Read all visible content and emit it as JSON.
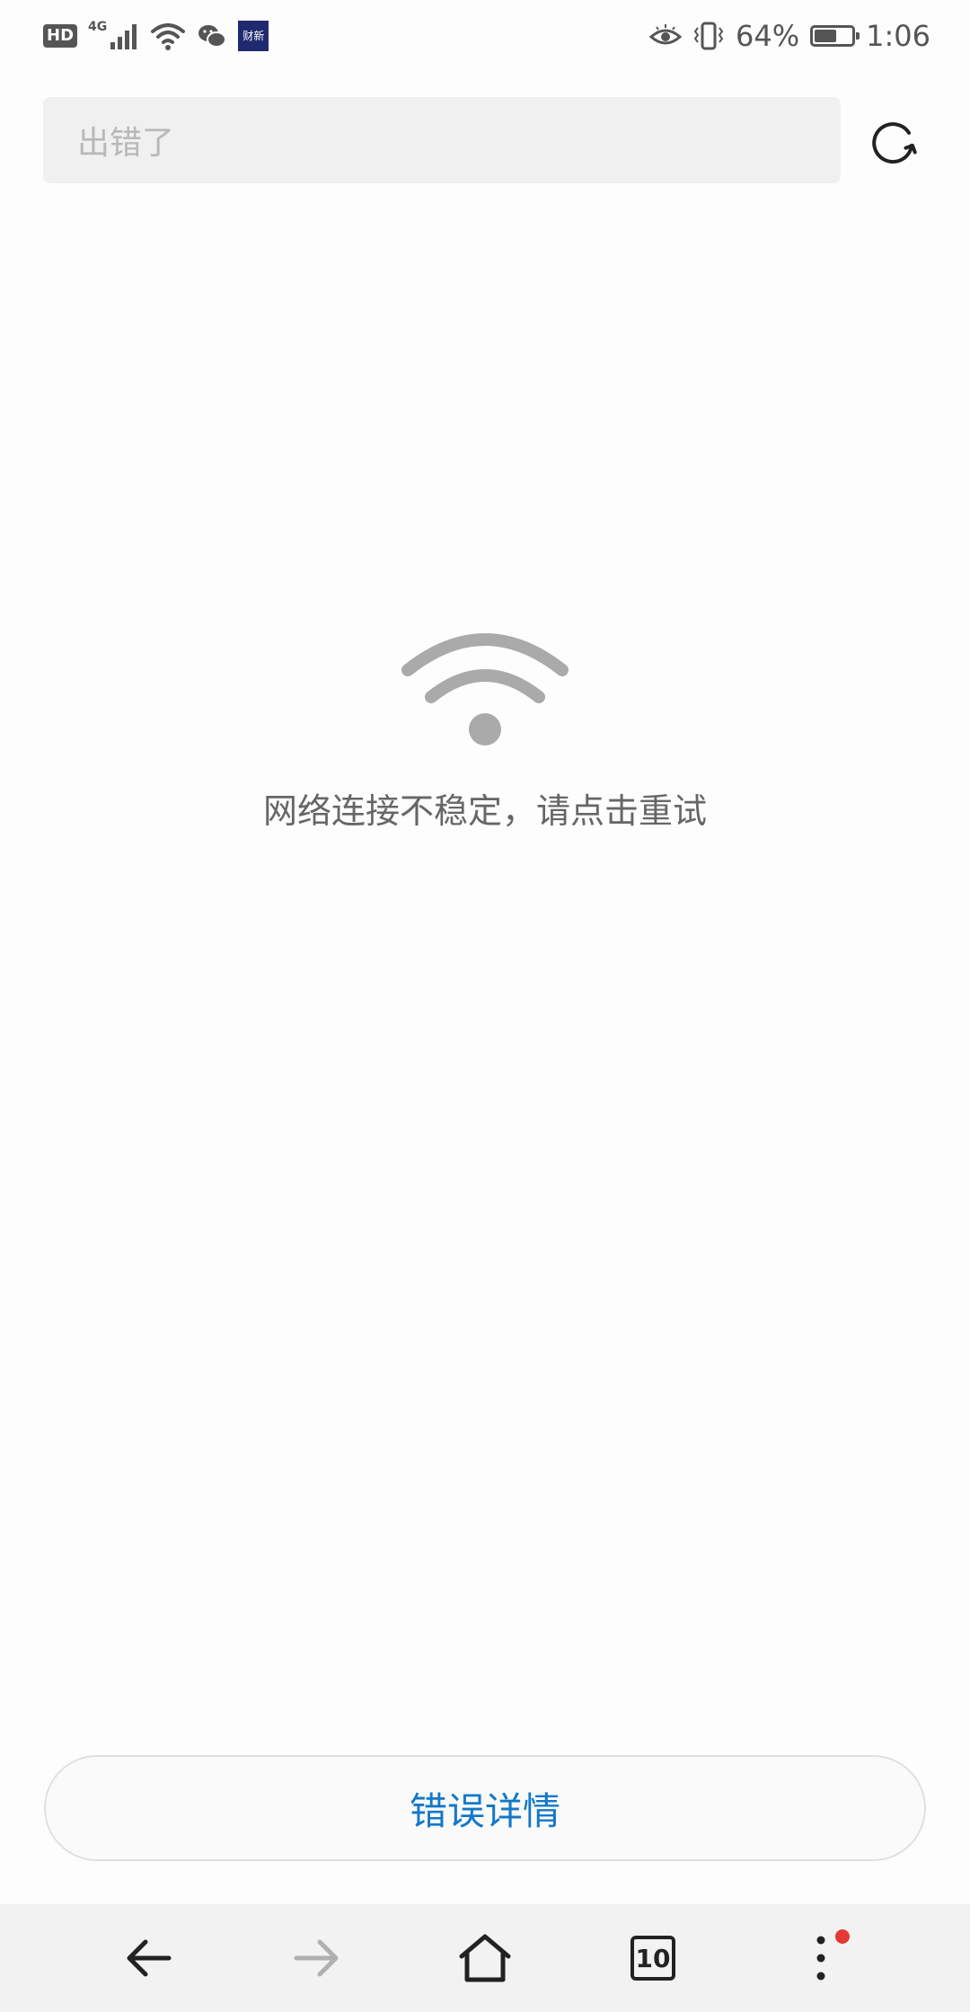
{
  "status_bar": {
    "hd_label": "HD",
    "network_type": "4G",
    "app_badge_label": "财新",
    "battery_percent": "64%",
    "battery_level": 0.64,
    "time": "1:06"
  },
  "url_bar": {
    "text": "出错了"
  },
  "error": {
    "message": "网络连接不稳定，请点击重试",
    "icon": "wifi-icon",
    "icon_color": "#aaaaaa"
  },
  "details_button": {
    "label": "错误详情",
    "color": "#1478c8"
  },
  "bottom_nav": {
    "tab_count": "10",
    "notification_dot_color": "#e53935"
  }
}
